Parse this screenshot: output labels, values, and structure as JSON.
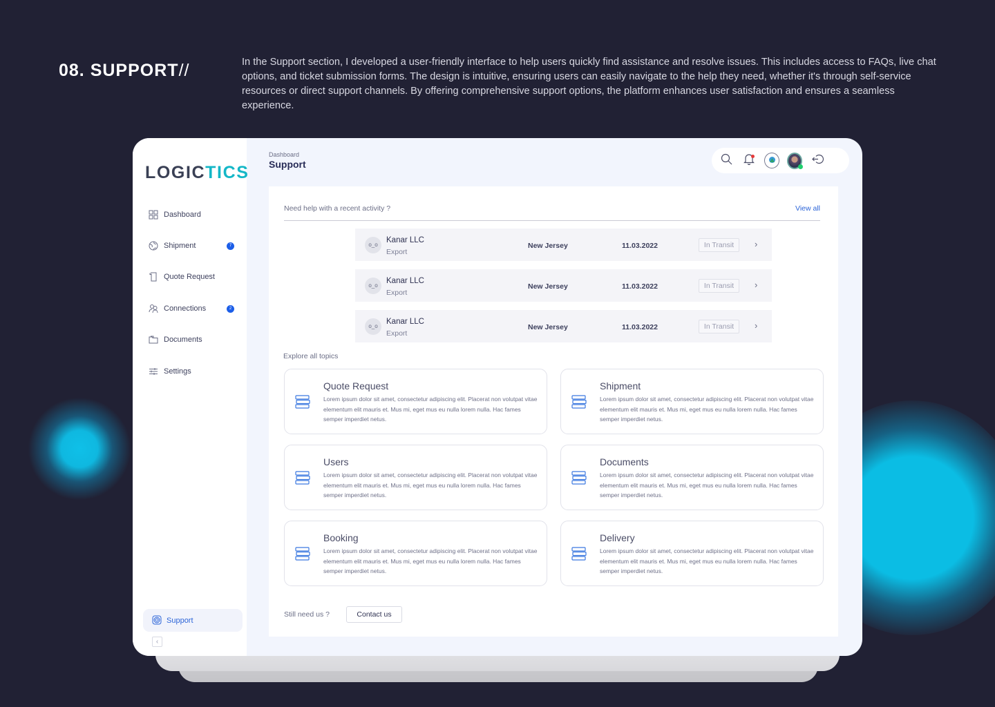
{
  "section": {
    "title": "08. SUPPORT",
    "title_suffix": "//",
    "description": "In the Support section, I developed a user-friendly interface to help users quickly find assistance and resolve issues. This includes access to FAQs, live chat options, and ticket submission forms. The design is intuitive, ensuring users can easily navigate to the help they need, whether it's through self-service resources or direct support channels. By offering comprehensive support options, the platform enhances user satisfaction and ensures a seamless experience."
  },
  "app": {
    "logo_primary": "LOGIC",
    "logo_accent": "TICS",
    "accent_color": "#14b7c7",
    "brand_blue": "#2b64d8"
  },
  "sidebar": {
    "items": [
      {
        "label": "Dashboard",
        "icon": "grid-icon"
      },
      {
        "label": "Shipment",
        "icon": "globe-icon",
        "badge": "7"
      },
      {
        "label": "Quote Request",
        "icon": "scroll-icon"
      },
      {
        "label": "Connections",
        "icon": "users-icon",
        "badge": "2"
      },
      {
        "label": "Documents",
        "icon": "folder-icon"
      },
      {
        "label": "Settings",
        "icon": "sliders-icon"
      }
    ],
    "support_label": "Support",
    "collapse_icon": "chevron-left-icon"
  },
  "header": {
    "breadcrumb": "Dashboard",
    "title": "Support",
    "actions": [
      "search-icon",
      "bell-icon",
      "organization-logo",
      "user-avatar",
      "logout-icon"
    ]
  },
  "recent": {
    "question": "Need help with a recent activity ?",
    "view_all": "View all",
    "rows": [
      {
        "avatar": "o_o",
        "name": "Kanar LLC",
        "type": "Export",
        "location": "New Jersey",
        "date": "11.03.2022",
        "status": "In Transit"
      },
      {
        "avatar": "o_o",
        "name": "Kanar LLC",
        "type": "Export",
        "location": "New Jersey",
        "date": "11.03.2022",
        "status": "In Transit"
      },
      {
        "avatar": "o_o",
        "name": "Kanar LLC",
        "type": "Export",
        "location": "New Jersey",
        "date": "11.03.2022",
        "status": "In Transit"
      }
    ]
  },
  "topics": {
    "heading": "Explore all topics",
    "cards": [
      {
        "title": "Quote Request",
        "desc": "Lorem ipsum dolor sit amet, consectetur adipiscing elit. Placerat non volutpat vitae elementum elit mauris et. Mus mi, eget mus eu nulla lorem nulla. Hac fames semper imperdiet netus."
      },
      {
        "title": "Shipment",
        "desc": "Lorem ipsum dolor sit amet, consectetur adipiscing elit. Placerat non volutpat vitae elementum elit mauris et. Mus mi, eget mus eu nulla lorem nulla. Hac fames semper imperdiet netus."
      },
      {
        "title": "Users",
        "desc": "Lorem ipsum dolor sit amet, consectetur adipiscing elit. Placerat non volutpat vitae elementum elit mauris et. Mus mi, eget mus eu nulla lorem nulla. Hac fames semper imperdiet netus."
      },
      {
        "title": "Documents",
        "desc": "Lorem ipsum dolor sit amet, consectetur adipiscing elit. Placerat non volutpat vitae elementum elit mauris et. Mus mi, eget mus eu nulla lorem nulla. Hac fames semper imperdiet netus."
      },
      {
        "title": "Booking",
        "desc": "Lorem ipsum dolor sit amet, consectetur adipiscing elit. Placerat non volutpat vitae elementum elit mauris et. Mus mi, eget mus eu nulla lorem nulla. Hac fames semper imperdiet netus."
      },
      {
        "title": "Delivery",
        "desc": "Lorem ipsum dolor sit amet, consectetur adipiscing elit. Placerat non volutpat vitae elementum elit mauris et. Mus mi, eget mus eu nulla lorem nulla. Hac fames semper imperdiet netus."
      }
    ]
  },
  "footer": {
    "still_need": "Still need us ?",
    "contact_label": "Contact us"
  }
}
